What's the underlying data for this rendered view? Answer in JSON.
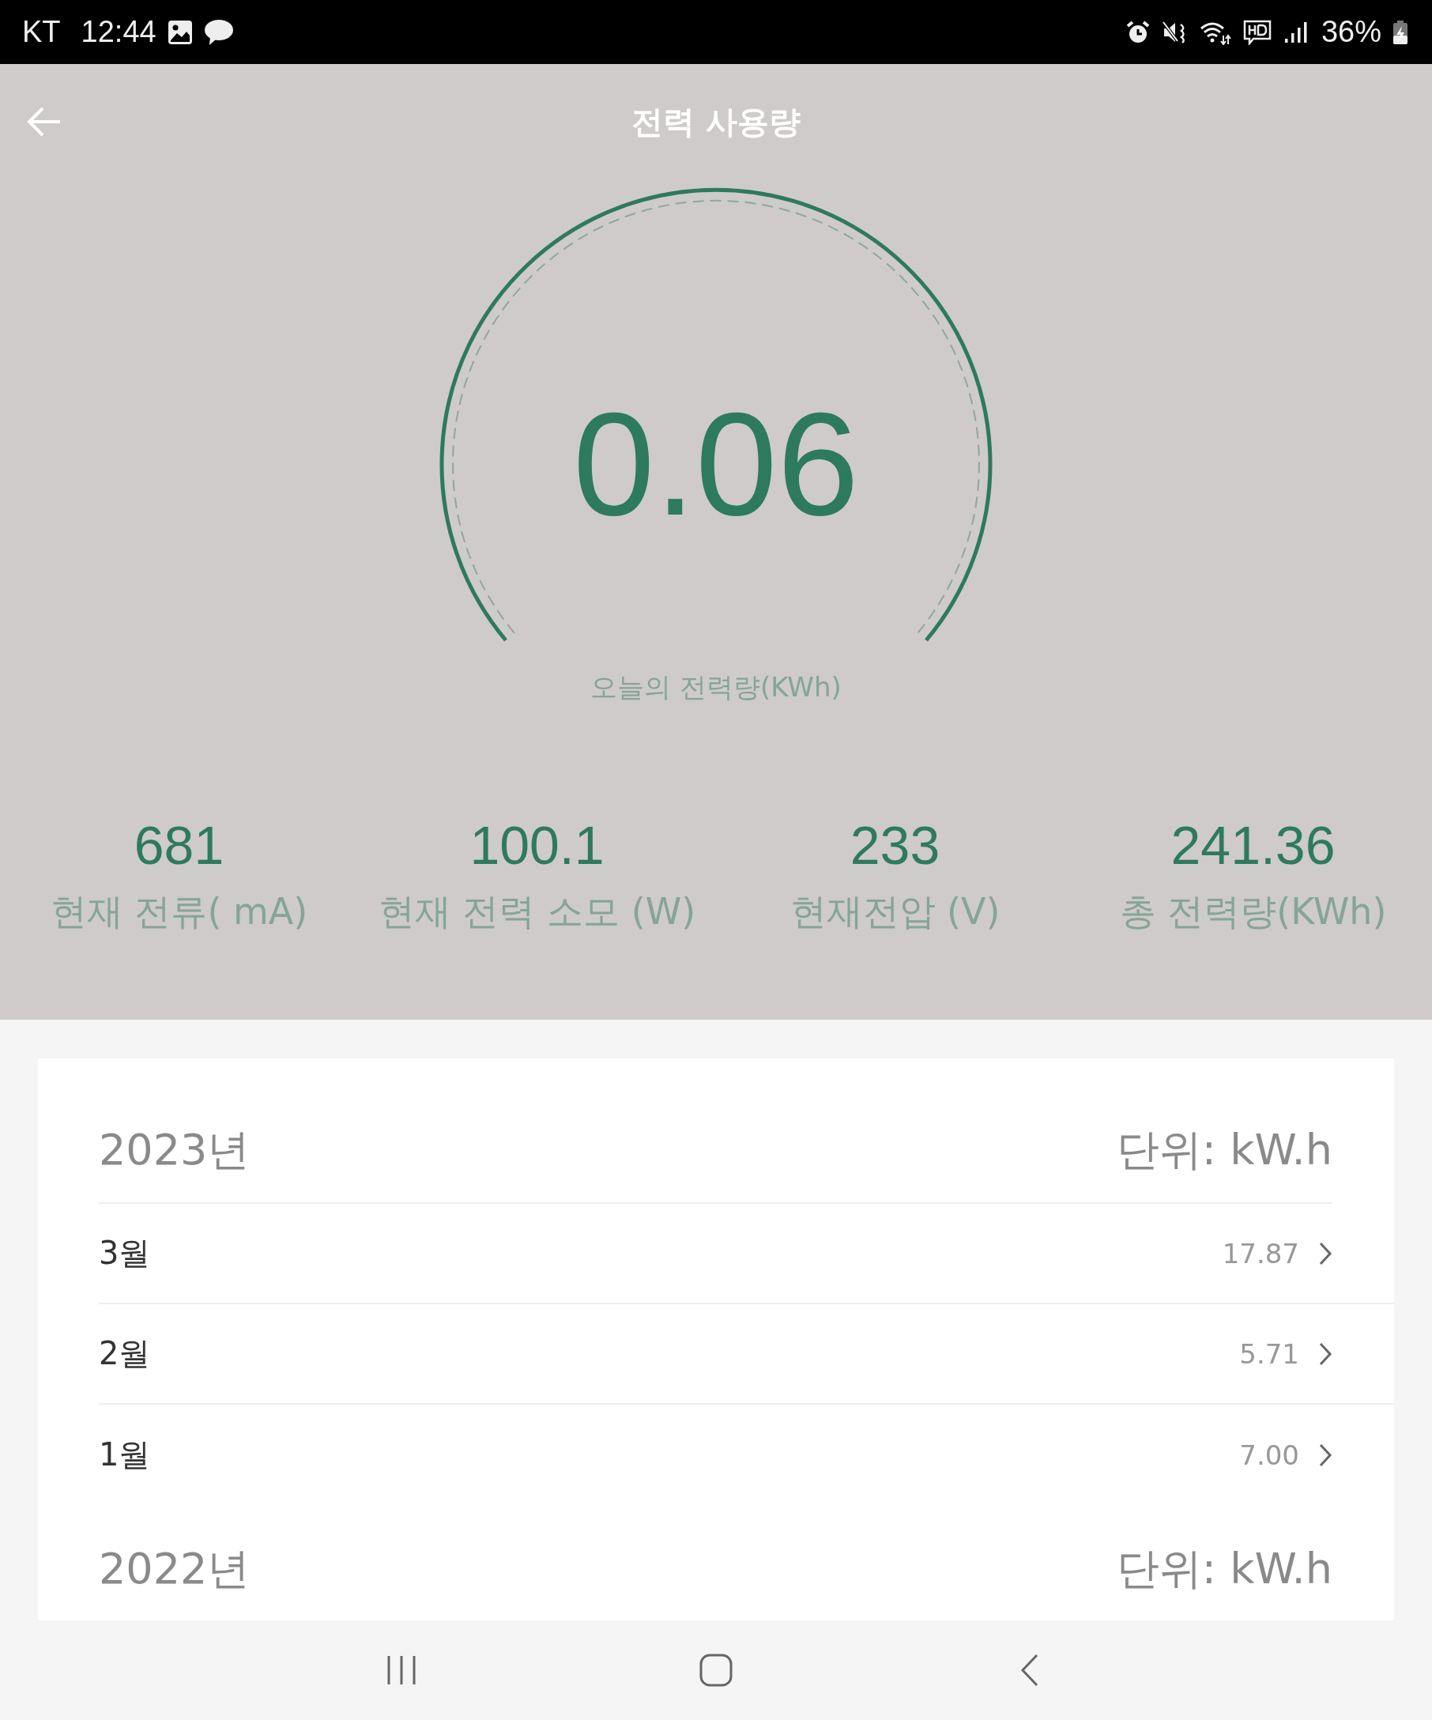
{
  "status_bar": {
    "carrier": "KT",
    "time": "12:44",
    "battery": "36%"
  },
  "header": {
    "title": "전력 사용량"
  },
  "gauge": {
    "value": "0.06",
    "label": "오늘의 전력량(KWh)"
  },
  "stats": [
    {
      "value": "681",
      "label": "현재 전류( mA)"
    },
    {
      "value": "100.1",
      "label": "현재 전력 소모 (W)"
    },
    {
      "value": "233",
      "label": "현재전압 (V)"
    },
    {
      "value": "241.36",
      "label": "총 전력량(KWh)"
    }
  ],
  "years": [
    {
      "year": "2023년",
      "unit": "단위: kW.h",
      "months": [
        {
          "month": "3월",
          "value": "17.87"
        },
        {
          "month": "2월",
          "value": "5.71"
        },
        {
          "month": "1월",
          "value": "7.00"
        }
      ]
    },
    {
      "year": "2022년",
      "unit": "단위: kW.h"
    }
  ]
}
